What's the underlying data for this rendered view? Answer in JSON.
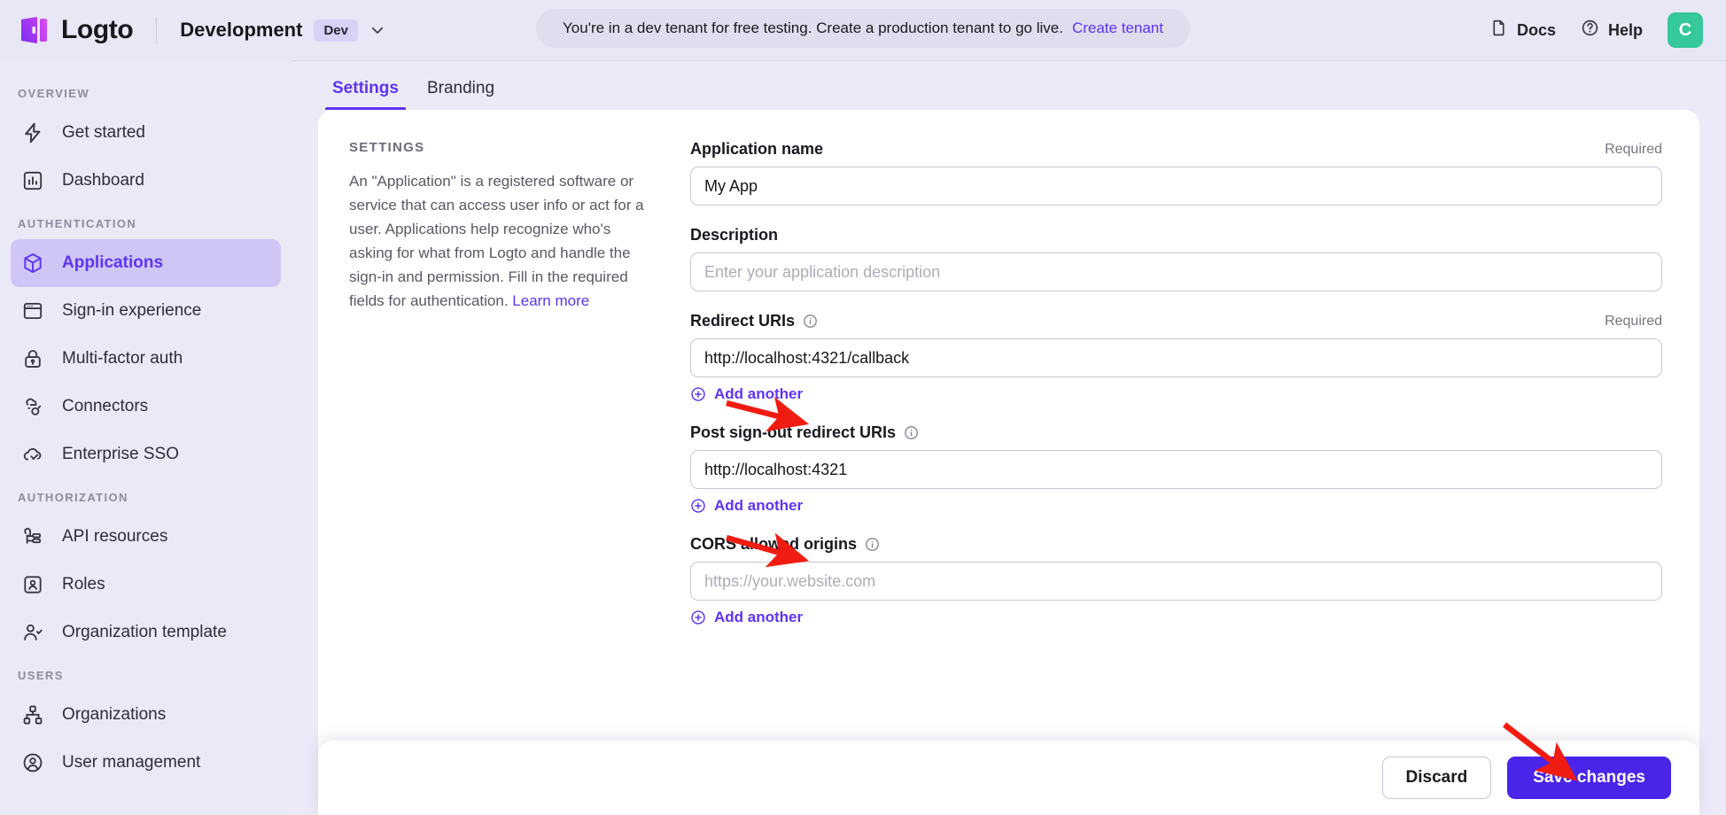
{
  "header": {
    "brand_name": "Logto",
    "tenant_name": "Development",
    "tenant_badge": "Dev",
    "banner_text": "You're in a dev tenant for free testing. Create a production tenant to go live.",
    "banner_link": "Create tenant",
    "docs_label": "Docs",
    "help_label": "Help",
    "avatar_initial": "C"
  },
  "sidebar": {
    "sections": [
      {
        "title": "Overview",
        "items": [
          {
            "label": "Get started",
            "icon": "bolt-icon",
            "active": false
          },
          {
            "label": "Dashboard",
            "icon": "chart-bar-icon",
            "active": false
          }
        ]
      },
      {
        "title": "Authentication",
        "items": [
          {
            "label": "Applications",
            "icon": "cube-icon",
            "active": true
          },
          {
            "label": "Sign-in experience",
            "icon": "browser-window-icon",
            "active": false
          },
          {
            "label": "Multi-factor auth",
            "icon": "lock-icon",
            "active": false
          },
          {
            "label": "Connectors",
            "icon": "connectors-icon",
            "active": false
          },
          {
            "label": "Enterprise SSO",
            "icon": "cloud-check-icon",
            "active": false
          }
        ]
      },
      {
        "title": "Authorization",
        "items": [
          {
            "label": "API resources",
            "icon": "api-resource-icon",
            "active": false
          },
          {
            "label": "Roles",
            "icon": "role-badge-icon",
            "active": false
          },
          {
            "label": "Organization template",
            "icon": "user-check-icon",
            "active": false
          }
        ]
      },
      {
        "title": "Users",
        "items": [
          {
            "label": "Organizations",
            "icon": "org-tree-icon",
            "active": false
          },
          {
            "label": "User management",
            "icon": "user-circle-icon",
            "active": false
          }
        ]
      }
    ]
  },
  "main": {
    "tabs": [
      {
        "label": "Settings",
        "active": true
      },
      {
        "label": "Branding",
        "active": false
      }
    ],
    "left_panel": {
      "title": "Settings",
      "description_part1": "An \"Application\" is a registered software or service that can access user info or act for a user. Applications help recognize who's asking for what from Logto and handle the sign-in and permission. Fill in the required fields for authentication. ",
      "learn_more": "Learn more"
    },
    "fields": [
      {
        "label": "Application name",
        "required_text": "Required",
        "value": "My App",
        "placeholder": "",
        "has_info": false,
        "add_another": ""
      },
      {
        "label": "Description",
        "required_text": "",
        "value": "",
        "placeholder": "Enter your application description",
        "has_info": false,
        "add_another": ""
      },
      {
        "label": "Redirect URIs",
        "required_text": "Required",
        "value": "http://localhost:4321/callback",
        "placeholder": "",
        "has_info": true,
        "add_another": "Add another"
      },
      {
        "label": "Post sign-out redirect URIs",
        "required_text": "",
        "value": "http://localhost:4321",
        "placeholder": "",
        "has_info": true,
        "add_another": "Add another"
      },
      {
        "label": "CORS allowed origins",
        "required_text": "",
        "value": "",
        "placeholder": "https://your.website.com",
        "has_info": true,
        "add_another": "Add another"
      }
    ],
    "footer": {
      "discard_label": "Discard",
      "save_label": "Save changes"
    }
  },
  "colors": {
    "accent": "#5d34f2",
    "primary_button": "#4a24e8",
    "avatar": "#35c89a",
    "annotation_arrow": "#f01c12",
    "sidebar_bg": "#eae9f6",
    "active_nav_bg": "#cfc6f7"
  }
}
